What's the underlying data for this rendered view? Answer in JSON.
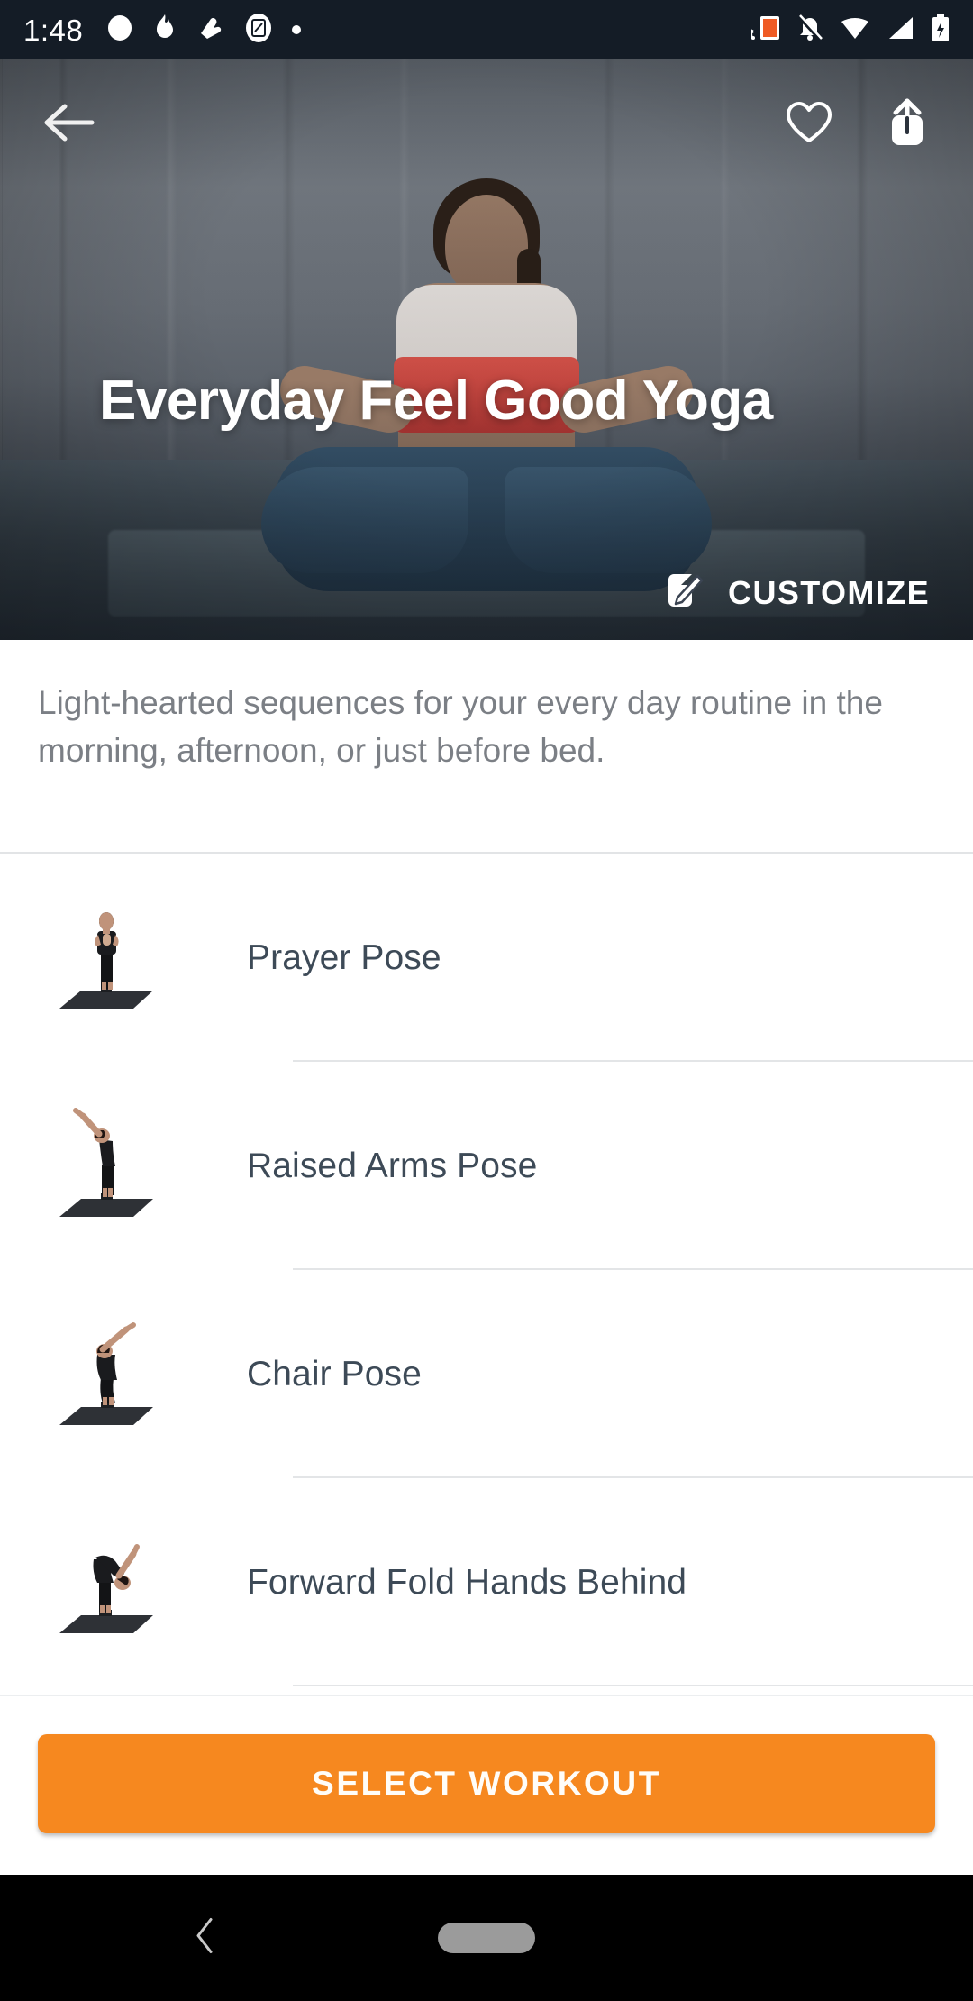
{
  "status_bar": {
    "time": "1:48",
    "left_icons": [
      "circle-indicator-icon",
      "flame-icon",
      "ribbon-icon",
      "app-square-icon",
      "dot-icon"
    ],
    "right_icons": [
      "cast-screen-icon",
      "notifications-off-icon",
      "wifi-icon",
      "cellular-signal-icon",
      "battery-charging-icon"
    ]
  },
  "hero": {
    "title": "Everyday Feel Good Yoga",
    "back_icon": "arrow-left-icon",
    "favorite_icon": "heart-outline-icon",
    "share_icon": "share-upload-icon",
    "customize_label": "CUSTOMIZE",
    "customize_icon": "edit-pencil-icon"
  },
  "description": {
    "text": "Light-hearted sequences for your every day routine in the morning, afternoon, or just before bed."
  },
  "poses": [
    {
      "name": "Prayer Pose",
      "thumbnail": "pose-prayer-thumbnail"
    },
    {
      "name": "Raised Arms Pose",
      "thumbnail": "pose-raised-arms-thumbnail"
    },
    {
      "name": "Chair Pose",
      "thumbnail": "pose-chair-thumbnail"
    },
    {
      "name": "Forward Fold Hands Behind",
      "thumbnail": "pose-forward-fold-hands-behind-thumbnail"
    }
  ],
  "bottom_bar": {
    "cta_label": "SELECT WORKOUT"
  },
  "nav_bar": {
    "back_icon": "nav-back-chevron-icon",
    "home_icon": "nav-home-pill-icon"
  },
  "colors": {
    "accent_orange": "#f6881f",
    "status_bar_bg": "#141c26",
    "list_text": "#3d4a57",
    "description_text": "#7b7f85",
    "divider": "#e3e5e7",
    "nav_bar_bg": "#000000"
  }
}
